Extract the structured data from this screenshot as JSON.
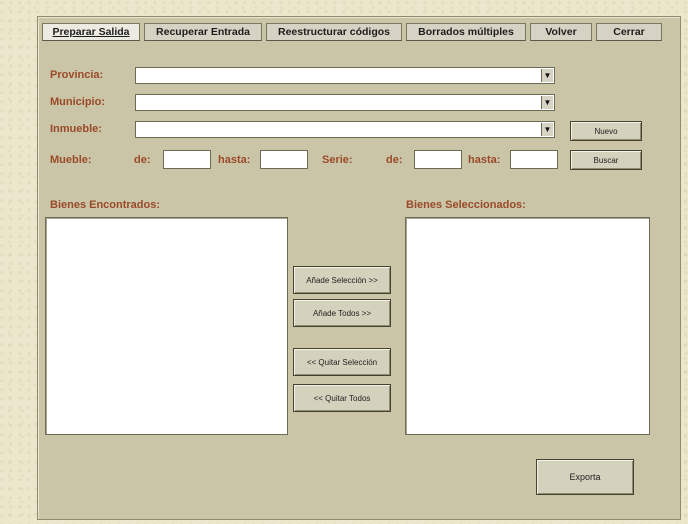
{
  "tabs": [
    {
      "label": "Preparar Salida",
      "active": true
    },
    {
      "label": "Recuperar Entrada",
      "active": false
    },
    {
      "label": "Reestructurar códigos",
      "active": false
    },
    {
      "label": "Borrados múltiples",
      "active": false
    },
    {
      "label": "Volver",
      "active": false
    },
    {
      "label": "Cerrar",
      "active": false
    }
  ],
  "form": {
    "provincia_label": "Provincia:",
    "municipio_label": "Municipio:",
    "inmueble_label": "Inmueble:",
    "mueble_label": "Mueble:",
    "serie_label": "Serie:",
    "de_label": "de:",
    "hasta_label": "hasta:"
  },
  "buttons": {
    "nuevo": "Nuevo",
    "buscar": "Buscar",
    "anade_seleccion": "Añade Selección >>",
    "anade_todos": "Añade Todos >>",
    "quitar_seleccion": "<< Quitar Selección",
    "quitar_todos": "<< Quitar Todos",
    "exportar": "Exporta"
  },
  "lists": {
    "encontrados_label": "Bienes Encontrados:",
    "seleccionados_label": "Bienes Seleccionados:"
  },
  "icons": {
    "dropdown": "chevron-down-icon"
  },
  "colors": {
    "panel": "#c9c5a6",
    "label": "#9a4a2a",
    "background": "#ebe6cc"
  }
}
